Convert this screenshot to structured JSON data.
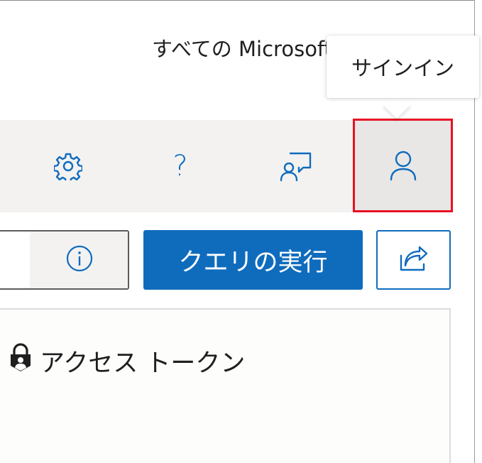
{
  "header": {
    "title": "すべての Microsoft"
  },
  "toolbar": {
    "help_glyph": "?"
  },
  "tooltip": {
    "text": "サインイン"
  },
  "actions": {
    "run_query_label": "クエリの実行"
  },
  "panel": {
    "title": "アクセス トークン"
  },
  "icons": {
    "settings": "gear-icon",
    "help": "question-icon",
    "feedback": "feedback-person-icon",
    "signin": "person-icon",
    "info": "info-icon",
    "share": "share-icon",
    "lock": "lock-person-icon"
  },
  "colors": {
    "accent": "#0f6cbd",
    "highlight_border": "#e81123",
    "toolbar_bg": "#f3f2f1"
  }
}
